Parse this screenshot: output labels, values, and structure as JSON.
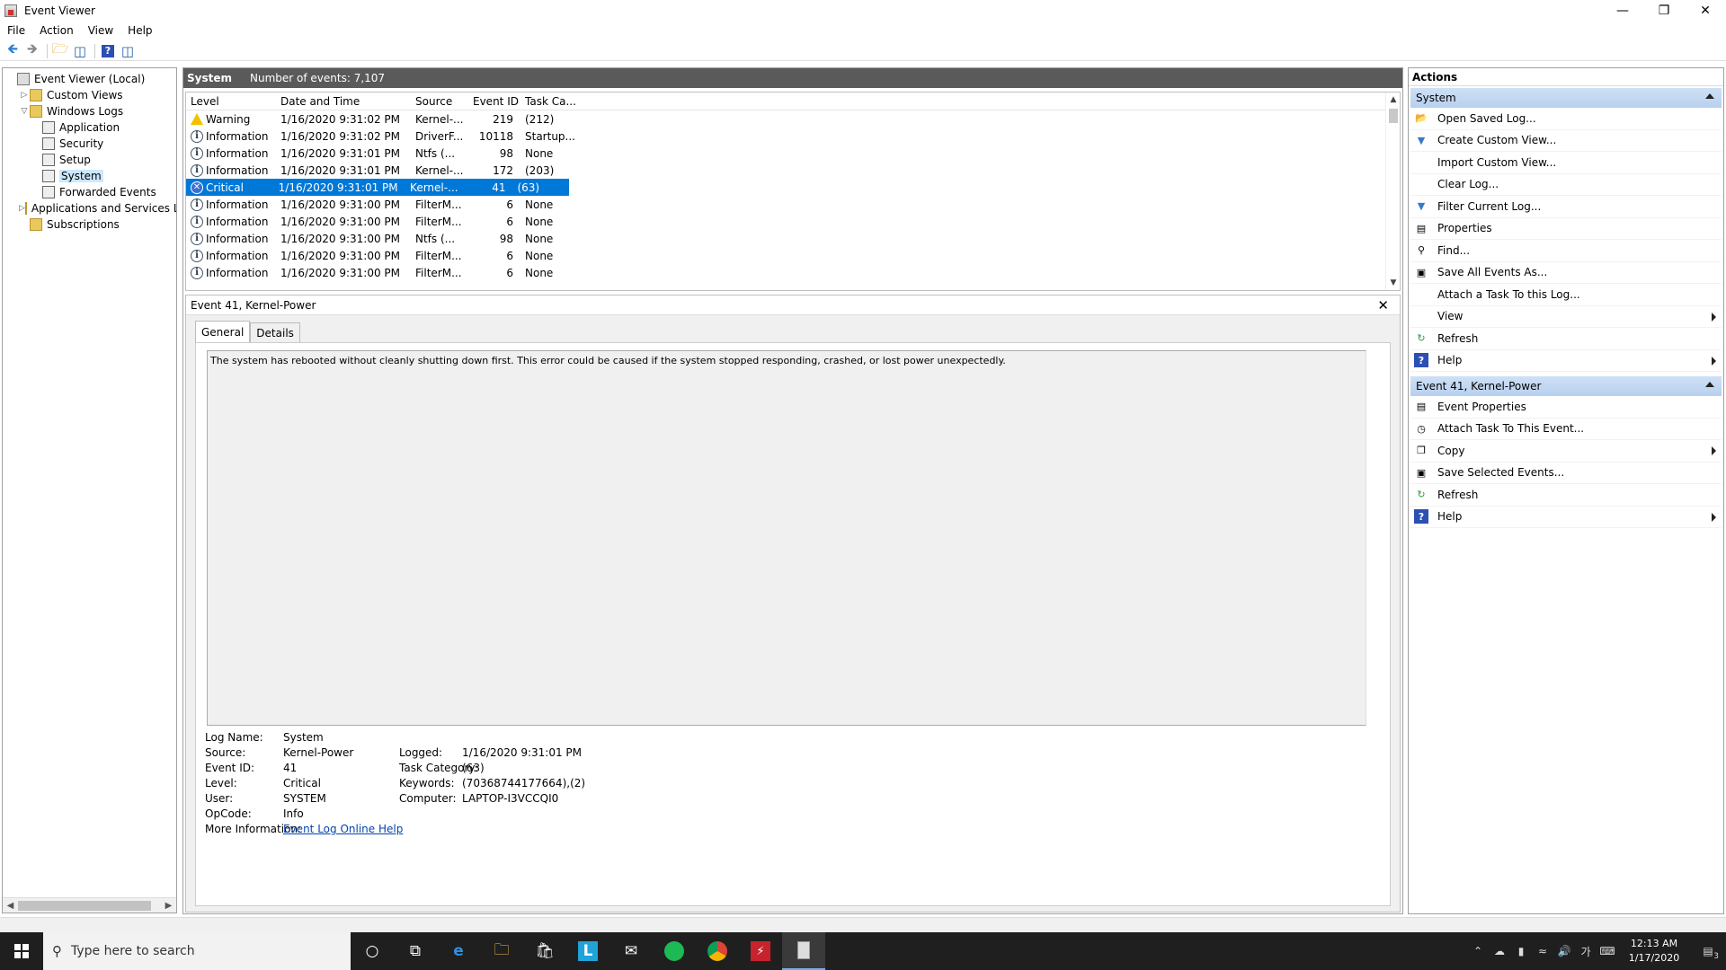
{
  "window": {
    "title": "Event Viewer"
  },
  "menu": [
    "File",
    "Action",
    "View",
    "Help"
  ],
  "tree": [
    {
      "label": "Event Viewer (Local)",
      "indent": 0,
      "exp": "",
      "icon": "root"
    },
    {
      "label": "Custom Views",
      "indent": 1,
      "exp": "▷",
      "icon": "folder"
    },
    {
      "label": "Windows Logs",
      "indent": 1,
      "exp": "▽",
      "icon": "folder"
    },
    {
      "label": "Application",
      "indent": 2,
      "exp": "",
      "icon": "log"
    },
    {
      "label": "Security",
      "indent": 2,
      "exp": "",
      "icon": "log"
    },
    {
      "label": "Setup",
      "indent": 2,
      "exp": "",
      "icon": "log"
    },
    {
      "label": "System",
      "indent": 2,
      "exp": "",
      "icon": "log",
      "selected": true
    },
    {
      "label": "Forwarded Events",
      "indent": 2,
      "exp": "",
      "icon": "log"
    },
    {
      "label": "Applications and Services Lo",
      "indent": 1,
      "exp": "▷",
      "icon": "folder"
    },
    {
      "label": "Subscriptions",
      "indent": 1,
      "exp": "",
      "icon": "folder"
    }
  ],
  "center": {
    "log_name": "System",
    "count_text": "Number of events: 7,107"
  },
  "columns": [
    "Level",
    "Date and Time",
    "Source",
    "Event ID",
    "Task Ca..."
  ],
  "events": [
    {
      "level": "Warning",
      "icon": "warn",
      "date": "1/16/2020 9:31:02 PM",
      "source": "Kernel-...",
      "id": "219",
      "task": "(212)"
    },
    {
      "level": "Information",
      "icon": "info",
      "date": "1/16/2020 9:31:02 PM",
      "source": "DriverF...",
      "id": "10118",
      "task": "Startup..."
    },
    {
      "level": "Information",
      "icon": "info",
      "date": "1/16/2020 9:31:01 PM",
      "source": "Ntfs (...",
      "id": "98",
      "task": "None"
    },
    {
      "level": "Information",
      "icon": "info",
      "date": "1/16/2020 9:31:01 PM",
      "source": "Kernel-...",
      "id": "172",
      "task": "(203)"
    },
    {
      "level": "Critical",
      "icon": "crit",
      "date": "1/16/2020 9:31:01 PM",
      "source": "Kernel-...",
      "id": "41",
      "task": "(63)",
      "selected": true
    },
    {
      "level": "Information",
      "icon": "info",
      "date": "1/16/2020 9:31:00 PM",
      "source": "FilterM...",
      "id": "6",
      "task": "None"
    },
    {
      "level": "Information",
      "icon": "info",
      "date": "1/16/2020 9:31:00 PM",
      "source": "FilterM...",
      "id": "6",
      "task": "None"
    },
    {
      "level": "Information",
      "icon": "info",
      "date": "1/16/2020 9:31:00 PM",
      "source": "Ntfs (...",
      "id": "98",
      "task": "None"
    },
    {
      "level": "Information",
      "icon": "info",
      "date": "1/16/2020 9:31:00 PM",
      "source": "FilterM...",
      "id": "6",
      "task": "None"
    },
    {
      "level": "Information",
      "icon": "info",
      "date": "1/16/2020 9:31:00 PM",
      "source": "FilterM...",
      "id": "6",
      "task": "None"
    }
  ],
  "detail": {
    "title": "Event 41, Kernel-Power",
    "tabs": [
      "General",
      "Details"
    ],
    "message": "The system has rebooted without cleanly shutting down first. This error could be caused if the system stopped responding, crashed, or lost power unexpectedly.",
    "props_left": [
      {
        "k": "Log Name:",
        "v": "System"
      },
      {
        "k": "Source:",
        "v": "Kernel-Power"
      },
      {
        "k": "Event ID:",
        "v": "41"
      },
      {
        "k": "Level:",
        "v": "Critical"
      },
      {
        "k": "User:",
        "v": "SYSTEM"
      },
      {
        "k": "OpCode:",
        "v": "Info"
      },
      {
        "k": "More Information:",
        "v": "Event Log Online Help",
        "link": true
      }
    ],
    "props_right": [
      {
        "k": "Logged:",
        "v": "1/16/2020 9:31:01 PM"
      },
      {
        "k": "Task Category:",
        "v": "(63)"
      },
      {
        "k": "Keywords:",
        "v": "(70368744177664),(2)"
      },
      {
        "k": "Computer:",
        "v": "LAPTOP-I3VCCQI0"
      }
    ]
  },
  "actions": {
    "header": "Actions",
    "sections": [
      {
        "title": "System",
        "items": [
          {
            "label": "Open Saved Log...",
            "icon": "open-log-icon",
            "sym": "📂"
          },
          {
            "label": "Create Custom View...",
            "icon": "filter-icon",
            "sym": "▼"
          },
          {
            "label": "Import Custom View...",
            "icon": "",
            "sym": ""
          },
          {
            "label": "Clear Log...",
            "icon": "",
            "sym": ""
          },
          {
            "label": "Filter Current Log...",
            "icon": "filter-icon",
            "sym": "▼"
          },
          {
            "label": "Properties",
            "icon": "properties-icon",
            "sym": "▤"
          },
          {
            "label": "Find...",
            "icon": "binoculars-icon",
            "sym": "⚲"
          },
          {
            "label": "Save All Events As...",
            "icon": "save-icon",
            "sym": "▣"
          },
          {
            "label": "Attach a Task To this Log...",
            "icon": "",
            "sym": ""
          },
          {
            "label": "View",
            "icon": "",
            "sym": "",
            "sub": true
          },
          {
            "label": "Refresh",
            "icon": "refresh-icon",
            "sym": "↻"
          },
          {
            "label": "Help",
            "icon": "help-icon",
            "sym": "?",
            "sub": true
          }
        ]
      },
      {
        "title": "Event 41, Kernel-Power",
        "items": [
          {
            "label": "Event Properties",
            "icon": "properties-icon",
            "sym": "▤"
          },
          {
            "label": "Attach Task To This Event...",
            "icon": "task-icon",
            "sym": "◷"
          },
          {
            "label": "Copy",
            "icon": "copy-icon",
            "sym": "❐",
            "sub": true
          },
          {
            "label": "Save Selected Events...",
            "icon": "save-icon",
            "sym": "▣"
          },
          {
            "label": "Refresh",
            "icon": "refresh-icon",
            "sym": "↻"
          },
          {
            "label": "Help",
            "icon": "help-icon",
            "sym": "?",
            "sub": true
          }
        ]
      }
    ]
  },
  "taskbar": {
    "search_placeholder": "Type here to search",
    "time": "12:13 AM",
    "date": "1/17/2020",
    "ime": "가",
    "notif_count": "3"
  }
}
